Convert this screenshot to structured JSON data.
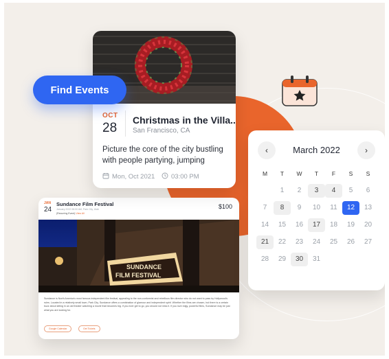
{
  "find_events_label": "Find Events",
  "christmas": {
    "month": "OCT",
    "day": "28",
    "title": "Christmas in the Villa...",
    "location": "San Francisco, CA",
    "description": "Picture the core of the city bustling with people partying, jumping",
    "date_meta": "Mon, Oct 2021",
    "time_meta": "03:00 PM"
  },
  "sundance": {
    "month": "JAN",
    "day": "24",
    "title": "Sundance Film Festival",
    "subtitle": "January 2022 08:00 AM, Park City, Utah",
    "recurring": "(Recurring Event)",
    "recurring_link": "View All",
    "price": "$100",
    "description": "Sundance is North America's most famous independent film festival, appealing to the non-conformist and rebellious film director who do not want to pass by Hollywood's rules. Located in a relatively small town, Park City, Sundance offers a combination of glamour and independent spirit. Whether the films are chosen, but there is a certain buzz about sitting in an old theater watching a movie that becomes big. If you ever get to go, you should not miss it. If you love edgy, powerful films, Sundance may be just what you are looking for.",
    "btn_google": "Google Calendar",
    "btn_tickets": "Get Tickets"
  },
  "calendar": {
    "title": "March 2022",
    "prev": "‹",
    "next": "›",
    "weekdays": [
      "M",
      "T",
      "W",
      "T",
      "F",
      "S",
      "S"
    ],
    "weeks": [
      [
        "",
        "1",
        "2",
        "3",
        "4",
        "5",
        "6"
      ],
      [
        "7",
        "8",
        "9",
        "10",
        "11",
        "12",
        "13"
      ],
      [
        "14",
        "15",
        "16",
        "17",
        "18",
        "19",
        "20"
      ],
      [
        "21",
        "22",
        "23",
        "24",
        "25",
        "26",
        "27"
      ],
      [
        "28",
        "29",
        "30",
        "31",
        "",
        "",
        ""
      ]
    ],
    "highlighted": [
      "3",
      "4",
      "8",
      "17",
      "21",
      "30"
    ],
    "selected": "12"
  },
  "colors": {
    "accent_blue": "#2f66f2",
    "accent_orange": "#e9652c",
    "background": "#f3efea"
  },
  "icons": [
    "calendar-star-icon",
    "calendar-icon",
    "clock-icon",
    "chevron-left-icon",
    "chevron-right-icon"
  ]
}
